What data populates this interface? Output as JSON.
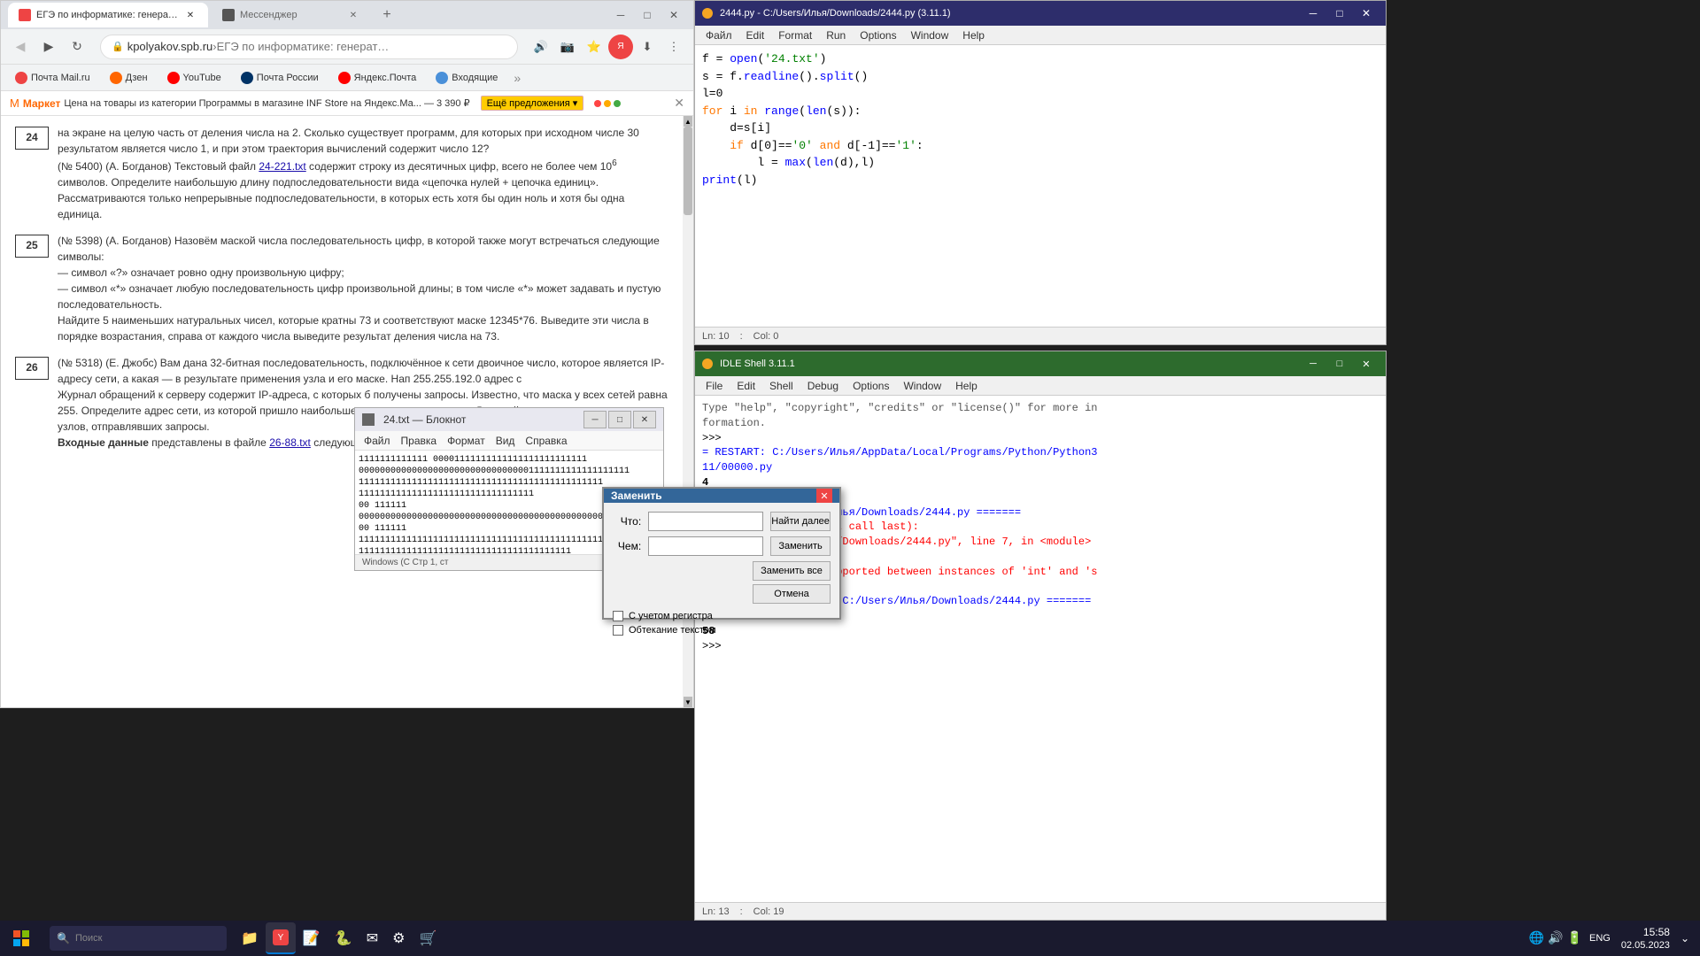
{
  "browser": {
    "title": "ЕГЭ по информатике: генератор в...",
    "tab1_label": "ЕГЭ по информатике: генератор в...",
    "tab2_label": "Мессенджер",
    "address": "kpolyakov.spb.ru",
    "address_display": "kpolyakov.spb.ru",
    "address_path": "ЕГЭ по информатике: генератор в...",
    "bookmarks": [
      {
        "label": "Почта Mail.ru",
        "color": "#e44"
      },
      {
        "label": "Дзен",
        "color": "#f60"
      },
      {
        "label": "YouTube",
        "color": "#f00"
      },
      {
        "label": "Почта России",
        "color": "#036"
      },
      {
        "label": "Яндекс.Почта",
        "color": "#f00"
      },
      {
        "label": "Входящие",
        "color": "#4a90d9"
      }
    ],
    "market_text": "Цена на товары из категории Программы в магазине INF Store на Яндекс.Ма... — 3 390 ₽",
    "market_btn": "Ещё предложения",
    "problems": [
      {
        "num": "24",
        "text": "на экране на целую часть от деления числа на 2. Сколько существует программ, для которых при исходном числе 30 результатом является число 1, и при этом траектория вычислений содержит число 12?\n(№ 5400) (А. Богданов) Текстовый файл 24-221.txt содержит строку из десятичных цифр, всего не более чем 10⁶ символов. Определите наибольшую длину подпоследовательности вида «цепочка нулей + цепочка единиц». Рассматриваются только непрерывные подпоследовательности, в которых есть хотя бы один ноль и хотя бы одна единица.",
        "link": "24-221.txt"
      },
      {
        "num": "25",
        "text": "(№ 5398) (А. Богданов) Назовём маской числа последовательность цифр, в которой также могут встречаться следующие символы:\n— символ «?» означает ровно одну произвольную цифру;\n— символ «*» означает любую последовательность цифр произвольной длины; в том числе «*» может задавать и пустую последовательность.\nНайдите 5 наименьших натуральных чисел, которые кратны 73 и соответствуют маске 12345*76. Выведите эти числа в порядке возрастания, справа от каждого числа выведите результат деления числа на 73."
      },
      {
        "num": "26",
        "text": "(№ 5318) (Е. Джобс) Вам дана 32-битная последовательность, подключённое к сети двоичное число, которое является IP-адресу сети, а какая — в результате применения узла и его маске. Нап 255.255.192.0 адрес с\nЖурнал обращений к серверу содержит IP-адреса, с которых б получены запросы. Известно, что маска у всех сетей равна 255. Определите адрес сети, из которой пришло наибольшее количество запросов. Для этой сети определите количество узлов, отправлявших запросы.\nВходные данные представлены в файле 26-88.txt следующим образом. В",
        "link1": "26-88.txt"
      }
    ]
  },
  "idle_editor": {
    "title": "2444.py - C:/Users/Илья/Downloads/2444.py (3.11.1)",
    "menubar": [
      "Файл",
      "Edit",
      "Format",
      "Run",
      "Options",
      "Window",
      "Help"
    ],
    "lines": [
      "f = open('24.txt')",
      "s = f.readline().split()",
      "l=0",
      "for i in range(len(s)):",
      "    d=s[i]",
      "    if d[0]=='0' and d[-1]=='1':",
      "        l = max(len(d),l)",
      "print(l)"
    ],
    "status_ln": "Ln: 10",
    "status_col": "Col: 0"
  },
  "idle_shell": {
    "title": "IDLE Shell 3.11.1",
    "menubar": [
      "File",
      "Edit",
      "Shell",
      "Debug",
      "Options",
      "Window",
      "Help"
    ],
    "content": [
      {
        "type": "info",
        "text": "Type \"help\", \"copyright\", \"credits\" or \"license()\" for more in"
      },
      {
        "type": "info",
        "text": "formation."
      },
      {
        "type": "prompt",
        "text": ">>> "
      },
      {
        "type": "restart",
        "text": "= RESTART: C:/Users/Илья/AppData/Local/Programs/Python/Python3\n11/00000.py"
      },
      {
        "type": "number",
        "text": "4"
      },
      {
        "type": "prompt",
        "text": ">>> "
      },
      {
        "type": "restart2",
        "text": "= RESTART: C:/Users/Илья/Downloads/2444.py ======"
      },
      {
        "type": "error",
        "text": "Traceback (most recent call last):"
      },
      {
        "type": "error2",
        "text": "  File \"C:/Users/Илья/Downloads/2444.py\", line 7, in <module>"
      },
      {
        "type": "error3",
        "text": "    l = max(len(d),l)"
      },
      {
        "type": "error4",
        "text": "TypeError: '>' not supported between instances of 'int' and 's"
      },
      {
        "type": "prompt2",
        "text": ">>> "
      },
      {
        "type": "restart3",
        "text": "============ RESTART: C:/Users/Илья/Downloads/2444.py =======\n======"
      },
      {
        "type": "number2",
        "text": "58"
      },
      {
        "type": "prompt3",
        "text": ">>> "
      }
    ],
    "status_ln": "Ln: 13",
    "status_col": "Col: 19"
  },
  "notepad": {
    "title": "24.txt — Блокнот",
    "menubar": [
      "Файл",
      "Правка",
      "Формат",
      "Вид",
      "Справка"
    ],
    "content": "1111111111111 00001111111111111111111111111\n0000000000000000000000000000000011111111111111111\n1111111111111111111111111111111111111111111111\n111111111111111111111111111111111\n00 111111\n0000000000000000000000000000000000000000000000000\n00 111111\n111111111111111111111111111111111111111111111111\n1111111111111111111111111111111111111111",
    "status": "Windows (C    Стр 1, ст"
  },
  "replace_dialog": {
    "title": "Заменить",
    "find_label": "Что:",
    "replace_label": "Чем:",
    "btn_find": "Найти далее",
    "btn_replace": "Заменить",
    "btn_replace_all": "Заменить все",
    "btn_cancel": "Отмена",
    "check1": "С учетом регистра",
    "check2": "Обтекание текстом"
  },
  "taskbar": {
    "time": "15:58",
    "date": "02.05.2023",
    "items": [
      {
        "label": "Пуск"
      },
      {
        "label": "Проводник"
      },
      {
        "label": "Браузер"
      },
      {
        "label": "Python IDLE"
      }
    ],
    "lang": "ENG"
  }
}
